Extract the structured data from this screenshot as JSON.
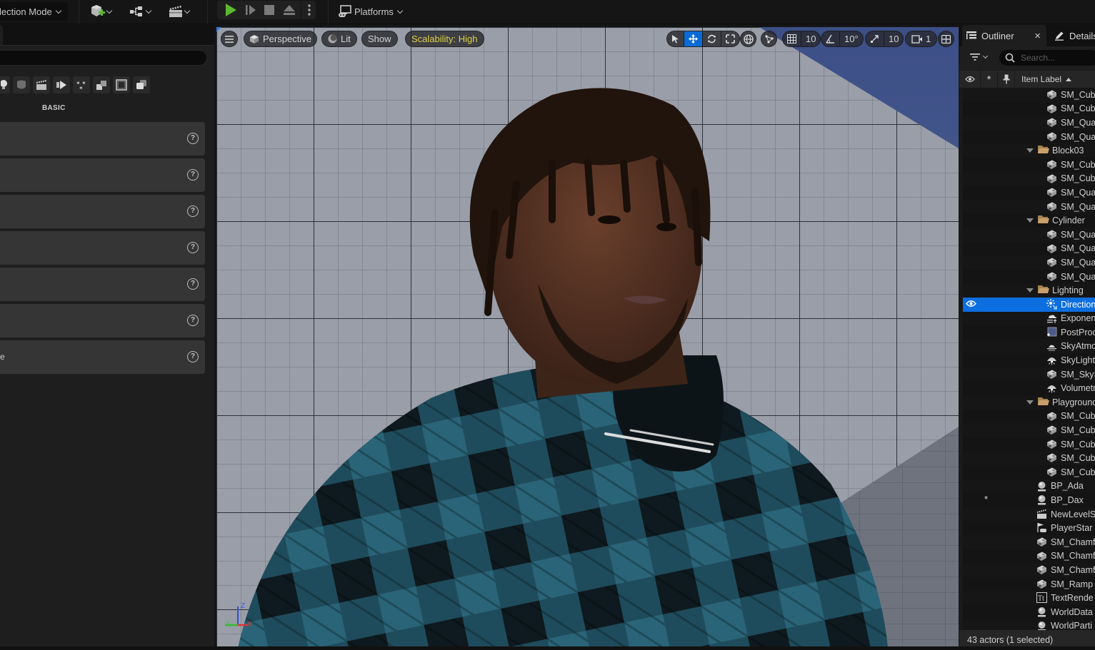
{
  "toolbar": {
    "mode_label": "lection Mode",
    "platforms_label": "Platforms",
    "colors": {
      "play_green": "#5cb82d",
      "accent_blue": "#0d6ee0",
      "scalability_yellow": "#e0d046"
    }
  },
  "place_actors": {
    "search_placeholder": "",
    "category_icons": [
      "lightbulb-icon",
      "shape-icon",
      "cinematic-icon",
      "visual-effects-icon",
      "all-classes-icon",
      "geometry-icon",
      "volumes-icon",
      "layers-icon"
    ],
    "category_label": "BASIC",
    "items": [
      {
        "name": ""
      },
      {
        "name": ""
      },
      {
        "name": ""
      },
      {
        "name": ""
      },
      {
        "name": ""
      },
      {
        "name": ""
      },
      {
        "name": "e"
      }
    ],
    "help_glyph": "?"
  },
  "viewport": {
    "perspective_label": "Perspective",
    "lit_label": "Lit",
    "show_label": "Show",
    "scalability_label": "Scalability: High",
    "grid_snap_value": "10",
    "rotation_snap_value": "10°",
    "scale_snap_value": "10",
    "camera_speed_value": "1",
    "axis_labels": {
      "x": "X",
      "y": "Y",
      "z": "Z"
    }
  },
  "outliner": {
    "tab_label": "Outliner",
    "close_glyph": "×",
    "details_tab_label": "Details",
    "search_placeholder": "Search...",
    "header_star": "*",
    "header_item_label": "Item Label",
    "rows": [
      {
        "label": "SM_Cube",
        "type": "mesh",
        "level": 2
      },
      {
        "label": "SM_Cube",
        "type": "mesh",
        "level": 2
      },
      {
        "label": "SM_Quad",
        "type": "mesh",
        "level": 2
      },
      {
        "label": "SM_Quad",
        "type": "mesh",
        "level": 2
      },
      {
        "label": "Block03",
        "type": "folder",
        "level": 1
      },
      {
        "label": "SM_Cube",
        "type": "mesh",
        "level": 2
      },
      {
        "label": "SM_Cube",
        "type": "mesh",
        "level": 2
      },
      {
        "label": "SM_Quad",
        "type": "mesh",
        "level": 2
      },
      {
        "label": "SM_Quad",
        "type": "mesh",
        "level": 2
      },
      {
        "label": "Cylinder",
        "type": "folder",
        "level": 1
      },
      {
        "label": "SM_Quad",
        "type": "mesh",
        "level": 2
      },
      {
        "label": "SM_Quad",
        "type": "mesh",
        "level": 2
      },
      {
        "label": "SM_Quad",
        "type": "mesh",
        "level": 2
      },
      {
        "label": "SM_Quad",
        "type": "mesh",
        "level": 2
      },
      {
        "label": "Lighting",
        "type": "folder",
        "level": 1
      },
      {
        "label": "Direction",
        "type": "light",
        "level": 2,
        "selected": true
      },
      {
        "label": "Exponen",
        "type": "fog",
        "level": 2
      },
      {
        "label": "PostProc",
        "type": "postprocess",
        "level": 2
      },
      {
        "label": "SkyAtmo",
        "type": "skyatmo",
        "level": 2
      },
      {
        "label": "SkyLight",
        "type": "skylight",
        "level": 2
      },
      {
        "label": "SM_SkyS",
        "type": "mesh",
        "level": 2
      },
      {
        "label": "Volumetr",
        "type": "skylight",
        "level": 2
      },
      {
        "label": "Playground",
        "type": "folder",
        "level": 1
      },
      {
        "label": "SM_Cube",
        "type": "mesh",
        "level": 2
      },
      {
        "label": "SM_Cube",
        "type": "mesh",
        "level": 2
      },
      {
        "label": "SM_Cube",
        "type": "mesh",
        "level": 2
      },
      {
        "label": "SM_Cube",
        "type": "mesh",
        "level": 2
      },
      {
        "label": "SM_Cube",
        "type": "mesh",
        "level": 2
      },
      {
        "label": "BP_Ada",
        "type": "actor",
        "level": 0
      },
      {
        "label": "BP_Dax",
        "type": "actor",
        "level": 0,
        "starred": true
      },
      {
        "label": "NewLevelS",
        "type": "sequence",
        "level": 0
      },
      {
        "label": "PlayerStar",
        "type": "playerstart",
        "level": 0
      },
      {
        "label": "SM_Chamf",
        "type": "mesh",
        "level": 0
      },
      {
        "label": "SM_Chamf",
        "type": "mesh",
        "level": 0
      },
      {
        "label": "SM_Chamf",
        "type": "mesh",
        "level": 0
      },
      {
        "label": "SM_Ramp",
        "type": "mesh",
        "level": 0
      },
      {
        "label": "TextRende",
        "type": "text",
        "level": 0
      },
      {
        "label": "WorldData",
        "type": "actor",
        "level": 0
      },
      {
        "label": "WorldParti",
        "type": "actor",
        "level": 0
      }
    ],
    "footer_status": "43 actors (1 selected)"
  }
}
